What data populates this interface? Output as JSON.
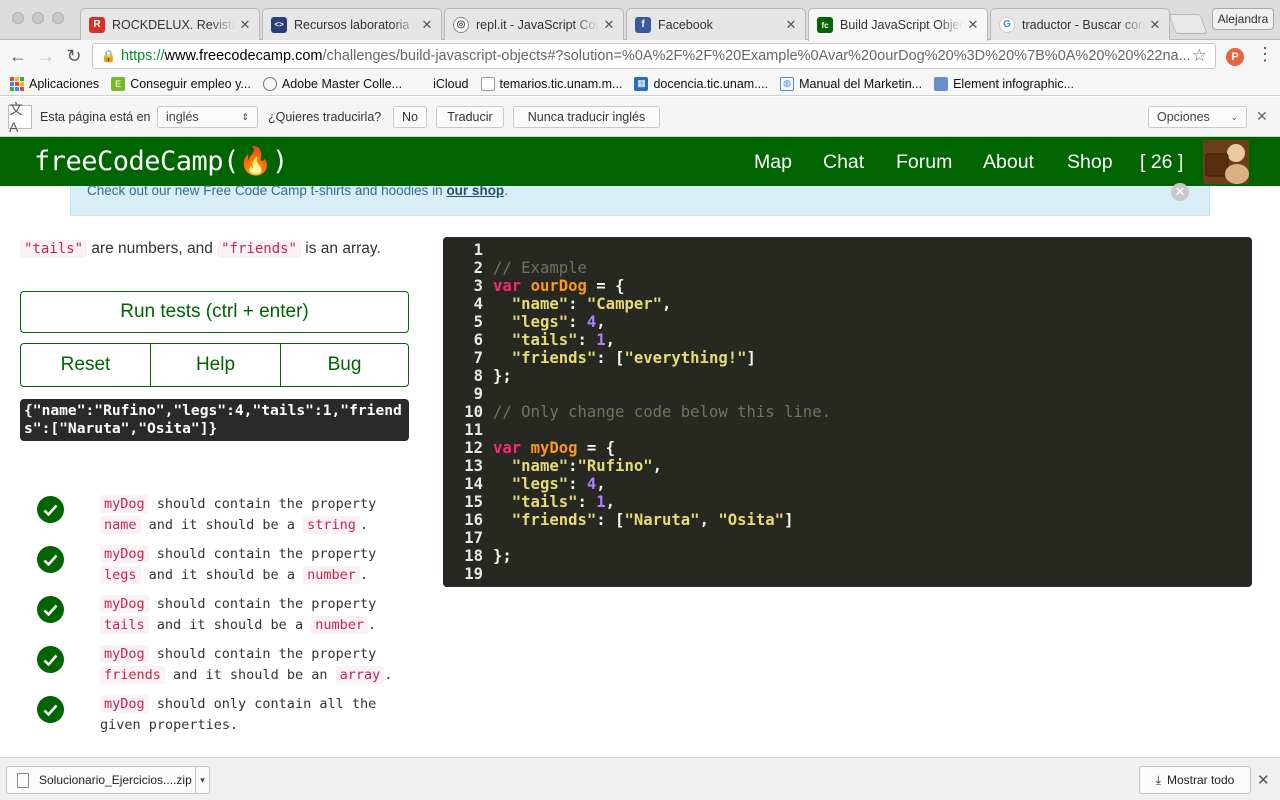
{
  "browser": {
    "tabs": [
      {
        "title": "ROCKDELUX. Revista",
        "favicon": "R"
      },
      {
        "title": "Recursos laboratoria",
        "favicon": "<>"
      },
      {
        "title": "repl.it - JavaScript Con",
        "favicon": "◎"
      },
      {
        "title": "Facebook",
        "favicon": "f"
      },
      {
        "title": "Build JavaScript Objec",
        "favicon": "fc"
      },
      {
        "title": "traductor - Buscar con",
        "favicon": "G"
      }
    ],
    "profile": "Alejandra",
    "url": {
      "protocol": "https://",
      "host": "www.freecodecamp.com",
      "path": "/challenges/build-javascript-objects#?solution=%0A%2F%2F%20Example%0Avar%20ourDog%20%3D%20%7B%0A%20%20%22na..."
    },
    "extension_letter": "P"
  },
  "bookmarks": [
    {
      "label": "Aplicaciones"
    },
    {
      "label": "Conseguir empleo y..."
    },
    {
      "label": "Adobe Master Colle..."
    },
    {
      "label": "iCloud"
    },
    {
      "label": "temarios.tic.unam.m..."
    },
    {
      "label": "docencia.tic.unam...."
    },
    {
      "label": "Manual del Marketin..."
    },
    {
      "label": "Element infographic..."
    }
  ],
  "translate_bar": {
    "prefix": "Esta página está en",
    "language": "inglés",
    "question": "¿Quieres traducirla?",
    "no": "No",
    "translate": "Traducir",
    "never": "Nunca traducir inglés",
    "options": "Opciones"
  },
  "fcc": {
    "logo": "freeCodeCamp(🔥)",
    "nav": [
      "Map",
      "Chat",
      "Forum",
      "About",
      "Shop"
    ],
    "points": "[ 26 ]",
    "alert_text": "Check out our new Free Code Camp t-shirts and hoodies in ",
    "alert_link": "our shop",
    "alert_end": "."
  },
  "challenge": {
    "desc_tails": "\"tails\"",
    "desc_mid": " are numbers, and ",
    "desc_friends": "\"friends\"",
    "desc_end": " is an array.",
    "run_label": "Run tests (ctrl + enter)",
    "reset_label": "Reset",
    "help_label": "Help",
    "bug_label": "Bug",
    "output": "{\"name\":\"Rufino\",\"legs\":4,\"tails\":1,\"friends\":[\"Naruta\",\"Osita\"]}",
    "tests": [
      {
        "obj": "myDog",
        "t1": " should contain the property",
        "prop": "name",
        "t2": " and it should be a ",
        "type": "string",
        "t3": "."
      },
      {
        "obj": "myDog",
        "t1": " should contain the property",
        "prop": "legs",
        "t2": " and it should be a ",
        "type": "number",
        "t3": "."
      },
      {
        "obj": "myDog",
        "t1": " should contain the property",
        "prop": "tails",
        "t2": " and it should be a ",
        "type": "number",
        "t3": "."
      },
      {
        "obj": "myDog",
        "t1": " should contain the property",
        "prop": "friends",
        "t2": " and it should be an ",
        "type": "array",
        "t3": "."
      },
      {
        "obj": "myDog",
        "t1": " should only contain all the given properties.",
        "prop": "",
        "t2": "",
        "type": "",
        "t3": ""
      }
    ]
  },
  "editor": {
    "lines": [
      [],
      [
        [
          "com",
          "// Example"
        ]
      ],
      [
        [
          "kw",
          "var"
        ],
        [
          "pl",
          " "
        ],
        [
          "var",
          "ourDog"
        ],
        [
          "pl",
          " = {"
        ]
      ],
      [
        [
          "pl",
          "  "
        ],
        [
          "str",
          "\"name\""
        ],
        [
          "pl",
          ": "
        ],
        [
          "str",
          "\"Camper\""
        ],
        [
          "pl",
          ","
        ]
      ],
      [
        [
          "pl",
          "  "
        ],
        [
          "str",
          "\"legs\""
        ],
        [
          "pl",
          ": "
        ],
        [
          "num",
          "4"
        ],
        [
          "pl",
          ","
        ]
      ],
      [
        [
          "pl",
          "  "
        ],
        [
          "str",
          "\"tails\""
        ],
        [
          "pl",
          ": "
        ],
        [
          "num",
          "1"
        ],
        [
          "pl",
          ","
        ]
      ],
      [
        [
          "pl",
          "  "
        ],
        [
          "str",
          "\"friends\""
        ],
        [
          "pl",
          ": ["
        ],
        [
          "str",
          "\"everything!\""
        ],
        [
          "pl",
          "]"
        ]
      ],
      [
        [
          "pl",
          "};"
        ]
      ],
      [],
      [
        [
          "com",
          "// Only change code below this line."
        ]
      ],
      [],
      [
        [
          "kw",
          "var"
        ],
        [
          "pl",
          " "
        ],
        [
          "var",
          "myDog"
        ],
        [
          "pl",
          " = {"
        ]
      ],
      [
        [
          "pl",
          "  "
        ],
        [
          "str",
          "\"name\""
        ],
        [
          "pl",
          ":"
        ],
        [
          "str",
          "\"Rufino\""
        ],
        [
          "pl",
          ","
        ]
      ],
      [
        [
          "pl",
          "  "
        ],
        [
          "str",
          "\"legs\""
        ],
        [
          "pl",
          ": "
        ],
        [
          "num",
          "4"
        ],
        [
          "pl",
          ","
        ]
      ],
      [
        [
          "pl",
          "  "
        ],
        [
          "str",
          "\"tails\""
        ],
        [
          "pl",
          ": "
        ],
        [
          "num",
          "1"
        ],
        [
          "pl",
          ","
        ]
      ],
      [
        [
          "pl",
          "  "
        ],
        [
          "str",
          "\"friends\""
        ],
        [
          "pl",
          ": ["
        ],
        [
          "str",
          "\"Naruta\""
        ],
        [
          "pl",
          ", "
        ],
        [
          "str",
          "\"Osita\""
        ],
        [
          "pl",
          "]"
        ]
      ],
      [],
      [
        [
          "pl",
          "};"
        ]
      ],
      []
    ]
  },
  "downloads": {
    "file": "Solucionario_Ejercicios....zip",
    "show_all": "Mostrar todo"
  },
  "colors": {
    "fcc_green": "#006400",
    "editor_bg": "#272822",
    "alert_bg": "#d9edf7"
  }
}
